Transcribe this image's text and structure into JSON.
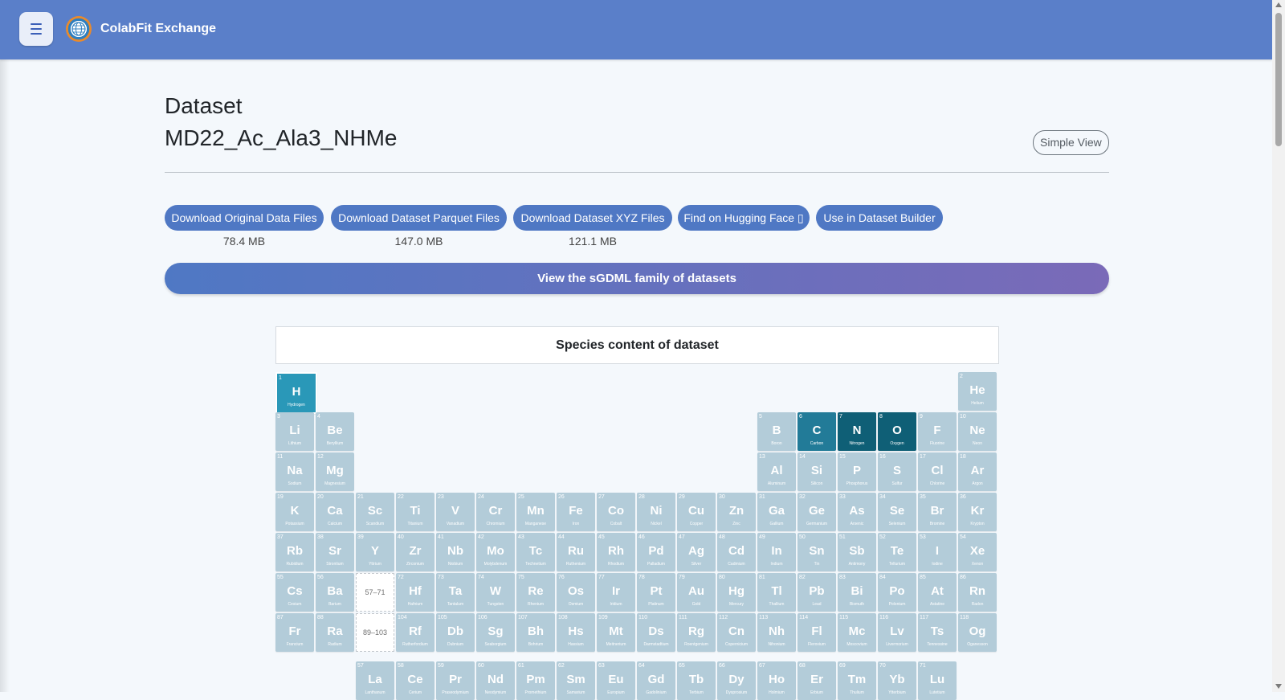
{
  "header": {
    "title": "ColabFit Exchange",
    "menu_icon": "hamburger-icon",
    "logo_icon": "globe-icon"
  },
  "page": {
    "heading": "Dataset",
    "dataset_name": "MD22_Ac_Ala3_NHMe",
    "simple_view_label": "Simple View"
  },
  "downloads": [
    {
      "label": "Download Original Data Files",
      "size": "78.4 MB"
    },
    {
      "label": "Download Dataset Parquet Files",
      "size": "147.0 MB"
    },
    {
      "label": "Download Dataset XYZ Files",
      "size": "121.1 MB"
    },
    {
      "label": "Find on Hugging Face ▯",
      "size": ""
    },
    {
      "label": "Use in Dataset Builder",
      "size": ""
    }
  ],
  "family_banner": "View the sGDML family of datasets",
  "species": {
    "title": "Species content of dataset",
    "present": [
      "H",
      "C",
      "N",
      "O"
    ],
    "placeholders": [
      "57–71",
      "89–103"
    ],
    "elements": [
      {
        "n": 1,
        "s": "H",
        "name": "Hydrogen",
        "p": 1,
        "g": 1
      },
      {
        "n": 2,
        "s": "He",
        "name": "Helium",
        "p": 1,
        "g": 18
      },
      {
        "n": 3,
        "s": "Li",
        "name": "Lithium",
        "p": 2,
        "g": 1
      },
      {
        "n": 4,
        "s": "Be",
        "name": "Beryllium",
        "p": 2,
        "g": 2
      },
      {
        "n": 5,
        "s": "B",
        "name": "Boron",
        "p": 2,
        "g": 13
      },
      {
        "n": 6,
        "s": "C",
        "name": "Carbon",
        "p": 2,
        "g": 14
      },
      {
        "n": 7,
        "s": "N",
        "name": "Nitrogen",
        "p": 2,
        "g": 15
      },
      {
        "n": 8,
        "s": "O",
        "name": "Oxygen",
        "p": 2,
        "g": 16
      },
      {
        "n": 9,
        "s": "F",
        "name": "Fluorine",
        "p": 2,
        "g": 17
      },
      {
        "n": 10,
        "s": "Ne",
        "name": "Neon",
        "p": 2,
        "g": 18
      },
      {
        "n": 11,
        "s": "Na",
        "name": "Sodium",
        "p": 3,
        "g": 1
      },
      {
        "n": 12,
        "s": "Mg",
        "name": "Magnesium",
        "p": 3,
        "g": 2
      },
      {
        "n": 13,
        "s": "Al",
        "name": "Aluminum",
        "p": 3,
        "g": 13
      },
      {
        "n": 14,
        "s": "Si",
        "name": "Silicon",
        "p": 3,
        "g": 14
      },
      {
        "n": 15,
        "s": "P",
        "name": "Phosphorus",
        "p": 3,
        "g": 15
      },
      {
        "n": 16,
        "s": "S",
        "name": "Sulfur",
        "p": 3,
        "g": 16
      },
      {
        "n": 17,
        "s": "Cl",
        "name": "Chlorine",
        "p": 3,
        "g": 17
      },
      {
        "n": 18,
        "s": "Ar",
        "name": "Argon",
        "p": 3,
        "g": 18
      },
      {
        "n": 19,
        "s": "K",
        "name": "Potassium",
        "p": 4,
        "g": 1
      },
      {
        "n": 20,
        "s": "Ca",
        "name": "Calcium",
        "p": 4,
        "g": 2
      },
      {
        "n": 21,
        "s": "Sc",
        "name": "Scandium",
        "p": 4,
        "g": 3
      },
      {
        "n": 22,
        "s": "Ti",
        "name": "Titanium",
        "p": 4,
        "g": 4
      },
      {
        "n": 23,
        "s": "V",
        "name": "Vanadium",
        "p": 4,
        "g": 5
      },
      {
        "n": 24,
        "s": "Cr",
        "name": "Chromium",
        "p": 4,
        "g": 6
      },
      {
        "n": 25,
        "s": "Mn",
        "name": "Manganese",
        "p": 4,
        "g": 7
      },
      {
        "n": 26,
        "s": "Fe",
        "name": "Iron",
        "p": 4,
        "g": 8
      },
      {
        "n": 27,
        "s": "Co",
        "name": "Cobalt",
        "p": 4,
        "g": 9
      },
      {
        "n": 28,
        "s": "Ni",
        "name": "Nickel",
        "p": 4,
        "g": 10
      },
      {
        "n": 29,
        "s": "Cu",
        "name": "Copper",
        "p": 4,
        "g": 11
      },
      {
        "n": 30,
        "s": "Zn",
        "name": "Zinc",
        "p": 4,
        "g": 12
      },
      {
        "n": 31,
        "s": "Ga",
        "name": "Gallium",
        "p": 4,
        "g": 13
      },
      {
        "n": 32,
        "s": "Ge",
        "name": "Germanium",
        "p": 4,
        "g": 14
      },
      {
        "n": 33,
        "s": "As",
        "name": "Arsenic",
        "p": 4,
        "g": 15
      },
      {
        "n": 34,
        "s": "Se",
        "name": "Selenium",
        "p": 4,
        "g": 16
      },
      {
        "n": 35,
        "s": "Br",
        "name": "Bromine",
        "p": 4,
        "g": 17
      },
      {
        "n": 36,
        "s": "Kr",
        "name": "Krypton",
        "p": 4,
        "g": 18
      },
      {
        "n": 37,
        "s": "Rb",
        "name": "Rubidium",
        "p": 5,
        "g": 1
      },
      {
        "n": 38,
        "s": "Sr",
        "name": "Strontium",
        "p": 5,
        "g": 2
      },
      {
        "n": 39,
        "s": "Y",
        "name": "Yttrium",
        "p": 5,
        "g": 3
      },
      {
        "n": 40,
        "s": "Zr",
        "name": "Zirconium",
        "p": 5,
        "g": 4
      },
      {
        "n": 41,
        "s": "Nb",
        "name": "Niobium",
        "p": 5,
        "g": 5
      },
      {
        "n": 42,
        "s": "Mo",
        "name": "Molybdenum",
        "p": 5,
        "g": 6
      },
      {
        "n": 43,
        "s": "Tc",
        "name": "Technetium",
        "p": 5,
        "g": 7
      },
      {
        "n": 44,
        "s": "Ru",
        "name": "Ruthenium",
        "p": 5,
        "g": 8
      },
      {
        "n": 45,
        "s": "Rh",
        "name": "Rhodium",
        "p": 5,
        "g": 9
      },
      {
        "n": 46,
        "s": "Pd",
        "name": "Palladium",
        "p": 5,
        "g": 10
      },
      {
        "n": 47,
        "s": "Ag",
        "name": "Silver",
        "p": 5,
        "g": 11
      },
      {
        "n": 48,
        "s": "Cd",
        "name": "Cadmium",
        "p": 5,
        "g": 12
      },
      {
        "n": 49,
        "s": "In",
        "name": "Indium",
        "p": 5,
        "g": 13
      },
      {
        "n": 50,
        "s": "Sn",
        "name": "Tin",
        "p": 5,
        "g": 14
      },
      {
        "n": 51,
        "s": "Sb",
        "name": "Antimony",
        "p": 5,
        "g": 15
      },
      {
        "n": 52,
        "s": "Te",
        "name": "Tellurium",
        "p": 5,
        "g": 16
      },
      {
        "n": 53,
        "s": "I",
        "name": "Iodine",
        "p": 5,
        "g": 17
      },
      {
        "n": 54,
        "s": "Xe",
        "name": "Xenon",
        "p": 5,
        "g": 18
      },
      {
        "n": 55,
        "s": "Cs",
        "name": "Cesium",
        "p": 6,
        "g": 1
      },
      {
        "n": 56,
        "s": "Ba",
        "name": "Barium",
        "p": 6,
        "g": 2
      },
      {
        "n": 72,
        "s": "Hf",
        "name": "Hafnium",
        "p": 6,
        "g": 4
      },
      {
        "n": 73,
        "s": "Ta",
        "name": "Tantalum",
        "p": 6,
        "g": 5
      },
      {
        "n": 74,
        "s": "W",
        "name": "Tungsten",
        "p": 6,
        "g": 6
      },
      {
        "n": 75,
        "s": "Re",
        "name": "Rhenium",
        "p": 6,
        "g": 7
      },
      {
        "n": 76,
        "s": "Os",
        "name": "Osmium",
        "p": 6,
        "g": 8
      },
      {
        "n": 77,
        "s": "Ir",
        "name": "Iridium",
        "p": 6,
        "g": 9
      },
      {
        "n": 78,
        "s": "Pt",
        "name": "Platinum",
        "p": 6,
        "g": 10
      },
      {
        "n": 79,
        "s": "Au",
        "name": "Gold",
        "p": 6,
        "g": 11
      },
      {
        "n": 80,
        "s": "Hg",
        "name": "Mercury",
        "p": 6,
        "g": 12
      },
      {
        "n": 81,
        "s": "Tl",
        "name": "Thallium",
        "p": 6,
        "g": 13
      },
      {
        "n": 82,
        "s": "Pb",
        "name": "Lead",
        "p": 6,
        "g": 14
      },
      {
        "n": 83,
        "s": "Bi",
        "name": "Bismuth",
        "p": 6,
        "g": 15
      },
      {
        "n": 84,
        "s": "Po",
        "name": "Polonium",
        "p": 6,
        "g": 16
      },
      {
        "n": 85,
        "s": "At",
        "name": "Astatine",
        "p": 6,
        "g": 17
      },
      {
        "n": 86,
        "s": "Rn",
        "name": "Radon",
        "p": 6,
        "g": 18
      },
      {
        "n": 87,
        "s": "Fr",
        "name": "Francium",
        "p": 7,
        "g": 1
      },
      {
        "n": 88,
        "s": "Ra",
        "name": "Radium",
        "p": 7,
        "g": 2
      },
      {
        "n": 104,
        "s": "Rf",
        "name": "Rutherfordium",
        "p": 7,
        "g": 4
      },
      {
        "n": 105,
        "s": "Db",
        "name": "Dubnium",
        "p": 7,
        "g": 5
      },
      {
        "n": 106,
        "s": "Sg",
        "name": "Seaborgium",
        "p": 7,
        "g": 6
      },
      {
        "n": 107,
        "s": "Bh",
        "name": "Bohrium",
        "p": 7,
        "g": 7
      },
      {
        "n": 108,
        "s": "Hs",
        "name": "Hassium",
        "p": 7,
        "g": 8
      },
      {
        "n": 109,
        "s": "Mt",
        "name": "Meitnerium",
        "p": 7,
        "g": 9
      },
      {
        "n": 110,
        "s": "Ds",
        "name": "Darmstadtium",
        "p": 7,
        "g": 10
      },
      {
        "n": 111,
        "s": "Rg",
        "name": "Roentgenium",
        "p": 7,
        "g": 11
      },
      {
        "n": 112,
        "s": "Cn",
        "name": "Copernicium",
        "p": 7,
        "g": 12
      },
      {
        "n": 113,
        "s": "Nh",
        "name": "Nihonium",
        "p": 7,
        "g": 13
      },
      {
        "n": 114,
        "s": "Fl",
        "name": "Flerovium",
        "p": 7,
        "g": 14
      },
      {
        "n": 115,
        "s": "Mc",
        "name": "Moscovium",
        "p": 7,
        "g": 15
      },
      {
        "n": 116,
        "s": "Lv",
        "name": "Livermorium",
        "p": 7,
        "g": 16
      },
      {
        "n": 117,
        "s": "Ts",
        "name": "Tennessine",
        "p": 7,
        "g": 17
      },
      {
        "n": 118,
        "s": "Og",
        "name": "Oganesson",
        "p": 7,
        "g": 18
      },
      {
        "n": 57,
        "s": "La",
        "name": "Lanthanum",
        "p": 9,
        "g": 3
      },
      {
        "n": 58,
        "s": "Ce",
        "name": "Cerium",
        "p": 9,
        "g": 4
      },
      {
        "n": 59,
        "s": "Pr",
        "name": "Praseodymium",
        "p": 9,
        "g": 5
      },
      {
        "n": 60,
        "s": "Nd",
        "name": "Neodymium",
        "p": 9,
        "g": 6
      },
      {
        "n": 61,
        "s": "Pm",
        "name": "Promethium",
        "p": 9,
        "g": 7
      },
      {
        "n": 62,
        "s": "Sm",
        "name": "Samarium",
        "p": 9,
        "g": 8
      },
      {
        "n": 63,
        "s": "Eu",
        "name": "Europium",
        "p": 9,
        "g": 9
      },
      {
        "n": 64,
        "s": "Gd",
        "name": "Gadolinium",
        "p": 9,
        "g": 10
      },
      {
        "n": 65,
        "s": "Tb",
        "name": "Terbium",
        "p": 9,
        "g": 11
      },
      {
        "n": 66,
        "s": "Dy",
        "name": "Dysprosium",
        "p": 9,
        "g": 12
      },
      {
        "n": 67,
        "s": "Ho",
        "name": "Holmium",
        "p": 9,
        "g": 13
      },
      {
        "n": 68,
        "s": "Er",
        "name": "Erbium",
        "p": 9,
        "g": 14
      },
      {
        "n": 69,
        "s": "Tm",
        "name": "Thulium",
        "p": 9,
        "g": 15
      },
      {
        "n": 70,
        "s": "Yb",
        "name": "Ytterbium",
        "p": 9,
        "g": 16
      },
      {
        "n": 71,
        "s": "Lu",
        "name": "Lutetium",
        "p": 9,
        "g": 17
      }
    ]
  }
}
